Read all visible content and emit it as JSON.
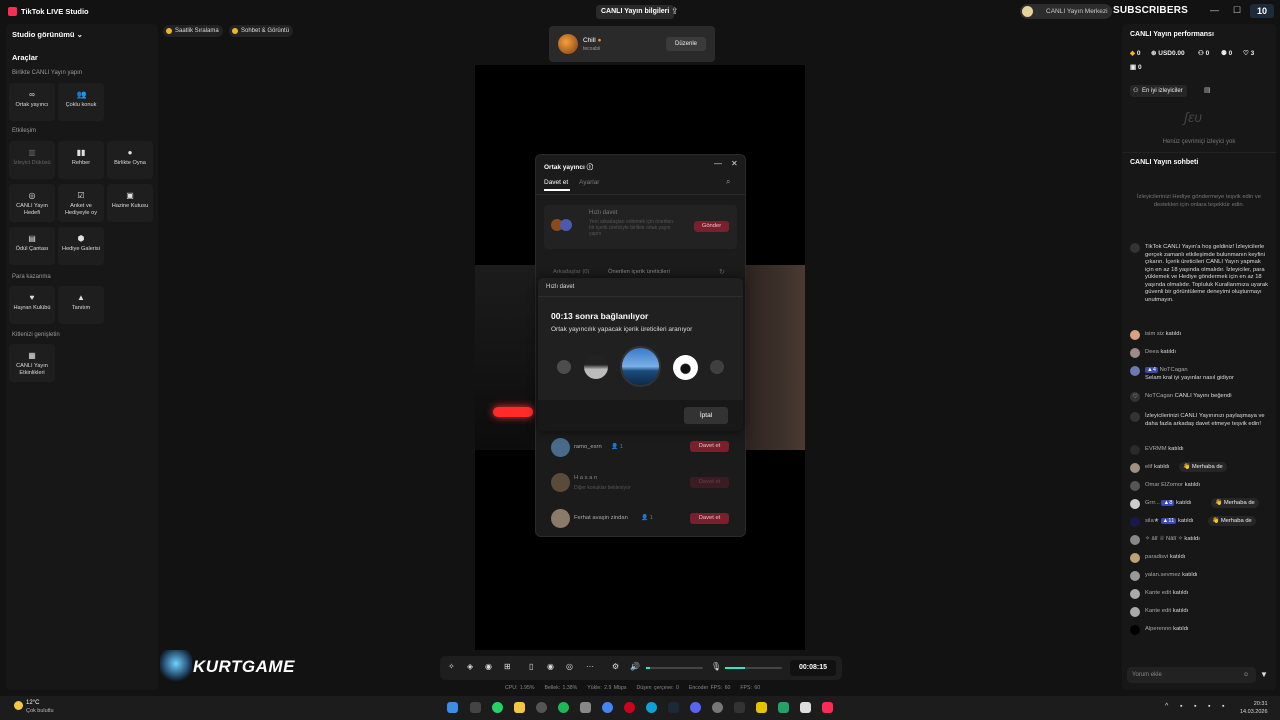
{
  "app": {
    "title": "TikTok LIVE Studio",
    "stream_info_button": "CANLI Yayın bilgileri",
    "center_label": "CANLI Yayın Merkezi",
    "subscribers_label": "SUBSCRIBERS",
    "subscribers_count": "10"
  },
  "sidebar": {
    "studio_view": "Studio görünümü",
    "tools_title": "Araçlar",
    "sections": {
      "together": "Birlikte CANLI Yayın yapın",
      "interaction": "Etkileşim",
      "monetize": "Para kazanma",
      "expand": "Kitlenizi genişletin"
    },
    "tools": {
      "cohost": "Ortak yayıncı",
      "multi_guest": "Çoklu konuk",
      "viewer_poll": "İzleyici Döküsü",
      "guide": "Rehber",
      "play_together": "Birlikte Oyna",
      "live_goal": "CANLI Yayın Hedefi",
      "poll_gift": "Anket ve Hediyeyle oy",
      "treasure_box": "Hazine Kutusu",
      "reward_bag": "Ödül Çantası",
      "gift_gallery": "Hediye Galerisi",
      "fan_club": "Hayran Kulübü",
      "promote": "Tanıtım",
      "live_events": "CANLI Yayın Etkinlikleri"
    }
  },
  "chips": {
    "hourly_ranking": "Saatlik Sıralama",
    "chat_view": "Sohbet & Görüntü"
  },
  "scene": {
    "name": "Chill",
    "sub": "tecoabii",
    "edit": "Düzenle"
  },
  "cohost_dialog": {
    "title": "Ortak yayıncı",
    "tab_invite": "Davet et",
    "tab_settings": "Ayarlar",
    "quick_title": "Hızlı davet",
    "quick_desc": "Yeni arkadaşları edinmek için önerilen bir içerik üreticiyle birlikte ortak yayın yapın",
    "send": "Gönder",
    "tab_friends": "Arkadaşlar (0)",
    "tab_suggested": "Önerilen içerik üreticileri",
    "rows": [
      {
        "name": "ramo_esrn",
        "count": "1",
        "action": "Davet et",
        "note": ""
      },
      {
        "name": "H a s a n",
        "count": "",
        "action": "Davet et",
        "note": "Diğer konuklar bekleniyor"
      },
      {
        "name": "Ferhat avaşin zindan",
        "count": "1",
        "action": "Davet et",
        "note": ""
      }
    ]
  },
  "quick_invite": {
    "title": "Hızlı davet",
    "countdown": "00:13 sonra bağlanılıyor",
    "searching": "Ortak yayıncılık yapacak içerik üreticileri aranıyor",
    "cancel": "İptal"
  },
  "toolbar": {
    "timer": "00:08:15"
  },
  "stats": {
    "cpu": "CPU: 1.95%",
    "memory": "Bellek: 1.38%",
    "upload": "Yükle: 2.9 Mbps",
    "dropped": "Düşen çerçeve: 0",
    "encoder_fps": "Encoder FPS: 60",
    "fps": "FPS: 60"
  },
  "watermark": {
    "text": "KURTGAME"
  },
  "right_panel": {
    "perf_title": "CANLI Yayın performansı",
    "diamonds": "0",
    "usd": "USD0.00",
    "viewers": "0",
    "new_followers": "0",
    "likes": "3",
    "shares": "0",
    "top_viewers": "En iyi izleyiciler",
    "no_viewers": "Henüz çevrimiçi izleyici yok",
    "chat_title": "CANLI Yayın sohbeti",
    "chat_hint": "İzleyicilerinizi Hediye göndermeye teşvik edin ve destekleri için onlara teşekkür edin.",
    "welcome": "TikTok CANLI Yayın'a hoş geldiniz! İzleyicilerle gerçek zamanlı etkileşimde bulunmanın keyfini çıkarın. İçerik üreticileri CANLI Yayın yapmak için en az 18 yaşında olmalıdır. İzleyiciler, para yüklemek ve Hediye göndermek için en az 18 yaşında olmalıdır. Topluluk Kurallarımıza uyarak güvenli bir görüntüleme deneyimi oluşturmayı unutmayın.",
    "joined": "katıldı",
    "hello": "Merhaba de",
    "share_prompt": "İzleyicilerinizi CANLI Yayınınızı paylaşmaya ve daha fazla arkadaş davet etmeye teşvik edin!",
    "messages": [
      {
        "user": "isim siz",
        "text": "katıldı"
      },
      {
        "user": "Deea",
        "text": "katıldı"
      },
      {
        "user": "NoTCagan",
        "text": "Selam kral iyi yayınlar nasıl gidiyor"
      },
      {
        "user": "NoTCagan",
        "text": "CANLI Yayını beğendi"
      },
      {
        "user": "EVRMM",
        "text": "katıldı"
      },
      {
        "user": "elif",
        "text": "katıldı"
      },
      {
        "user": "Omar ElZomor",
        "text": "katıldı"
      },
      {
        "user": "Grrr...",
        "text": "katıldı"
      },
      {
        "user": "sila★",
        "text": "katıldı"
      },
      {
        "user": "✧ âlî ♕ Nâlî ✧",
        "text": "katıldı"
      },
      {
        "user": "paradisvi",
        "text": "katıldı"
      },
      {
        "user": "yalan.sevmez",
        "text": "katıldı"
      },
      {
        "user": "Kante edit",
        "text": "katıldı"
      },
      {
        "user": "Kante edit",
        "text": "katıldı"
      },
      {
        "user": "Alperennn",
        "text": "katıldı"
      }
    ],
    "badges": {
      "notcagan": "4",
      "grrr": "8",
      "sila": "11"
    },
    "comment_placeholder": "Yorum ekle"
  },
  "taskbar": {
    "temp": "12°C",
    "weather": "Çok bulutlu",
    "time": "20:31",
    "date": "14.03.2026"
  }
}
